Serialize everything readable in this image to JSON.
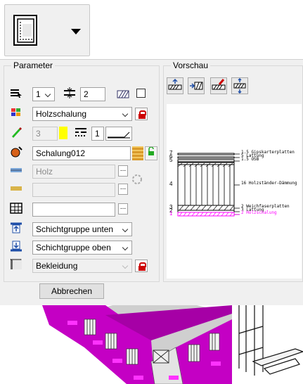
{
  "toolbar": {
    "tool_icon": "layer-wall-icon",
    "dropdown_icon": "triangle-down-icon"
  },
  "parameter": {
    "legend": "Parameter",
    "row1": {
      "layer_select": "1",
      "thickness_value": "2"
    },
    "material": "Holzschalung",
    "pen": {
      "value": "3",
      "color": "#ffff00",
      "linetype_value": "1"
    },
    "surface": "Schalung012",
    "row_material": "Holz",
    "row_empty": "",
    "row_text": "",
    "schichtgruppe_unten": "Schichtgruppe unten",
    "schichtgruppe_oben": "Schichtgruppe oben",
    "bekleidung": "Bekleidung",
    "dots": "..."
  },
  "vorschau": {
    "legend": "Vorschau",
    "layers": [
      {
        "num": "7",
        "label": "1.5 Gipskarterplatten"
      },
      {
        "num": "6",
        "label": "5 Lattung"
      },
      {
        "num": "5",
        "label": "1.5 OSB"
      },
      {
        "num": "4",
        "label": "16 Holzständer-Dämmung"
      },
      {
        "num": "3",
        "label": "2 Weichfaserplatten"
      },
      {
        "num": "2",
        "label": "3 Lattung"
      },
      {
        "num": "1",
        "label": "2 Holzschalung"
      }
    ],
    "highlight_color": "#ff00ff"
  },
  "buttons": {
    "cancel": "Abbrechen"
  },
  "colors": {
    "building_magenta": "#cc00cc",
    "dialog_bg": "#f0f0f0"
  }
}
